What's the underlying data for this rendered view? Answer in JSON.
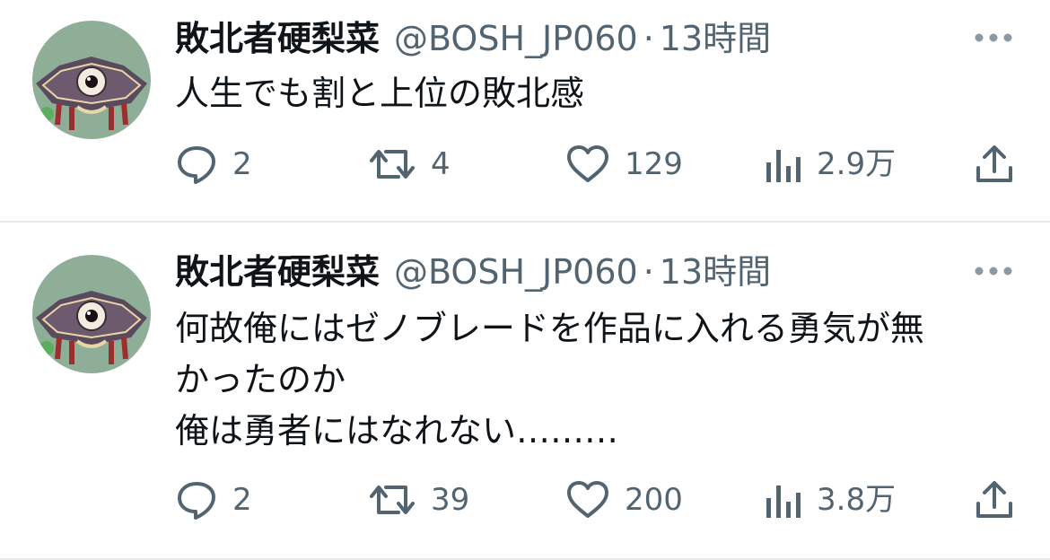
{
  "tweets": [
    {
      "display_name": "敗北者硬梨菜",
      "handle": "@BOSH_JP060",
      "separator": "·",
      "time": "13時間",
      "text": "人生でも割と上位の敗北感",
      "replies": "2",
      "retweets": "4",
      "likes": "129",
      "views": "2.9万"
    },
    {
      "display_name": "敗北者硬梨菜",
      "handle": "@BOSH_JP060",
      "separator": "·",
      "time": "13時間",
      "text": "何故俺にはゼノブレードを作品に入れる勇気が無\nかったのか\n俺は勇者にはなれない………",
      "replies": "2",
      "retweets": "39",
      "likes": "200",
      "views": "3.8万"
    }
  ],
  "icons": {
    "avatar": "avatar-emblem-icon",
    "more": "more-horizontal-icon",
    "reply": "reply-bubble-icon",
    "retweet": "retweet-icon",
    "like": "heart-icon",
    "views": "bar-chart-icon",
    "share": "share-upload-icon"
  },
  "colors": {
    "text_primary": "#0f1419",
    "text_secondary": "#536471",
    "divider": "#e6e9eb",
    "avatar_bg": "#8fae98"
  }
}
